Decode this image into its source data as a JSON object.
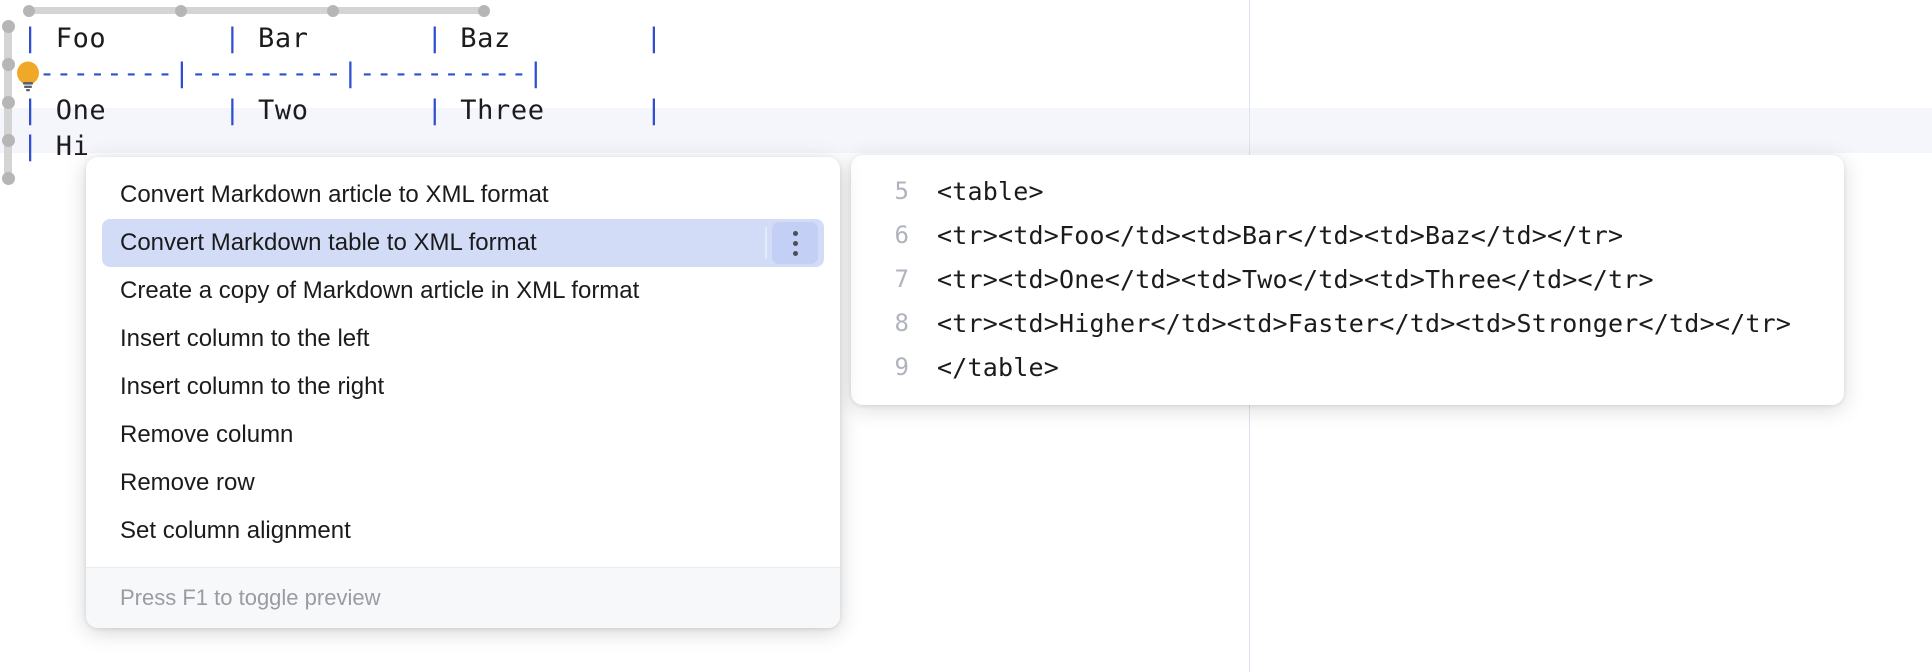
{
  "editor": {
    "markdown_lines": [
      {
        "id": "header",
        "text": "| Foo       | Bar       | Baz        |"
      },
      {
        "id": "separator",
        "text": "|---------|---------|----------|"
      },
      {
        "id": "row_one",
        "text": "| One       | Two       | Three      |"
      },
      {
        "id": "row_higher",
        "text": "| Hi"
      }
    ],
    "table": {
      "headers": [
        "Foo",
        "Bar",
        "Baz"
      ],
      "rows": [
        [
          "One",
          "Two",
          "Three"
        ],
        [
          "Higher",
          "Faster",
          "Stronger"
        ]
      ]
    },
    "column_handles": {
      "count": 4,
      "name": "column-resize-handle"
    },
    "row_handles": {
      "count": 5,
      "name": "row-select-handle"
    },
    "intention_icon": "lightbulb-icon",
    "margin_guide_color": "#dde3f0",
    "caret_row_highlight_color": "#f4f6fb",
    "pipe_color": "#2f4fd0",
    "text_color": "#1c1c1e"
  },
  "intention_popup": {
    "items": [
      {
        "label": "Convert Markdown article to XML format",
        "selected": false
      },
      {
        "label": "Convert Markdown table to XML format",
        "selected": true
      },
      {
        "label": "Create a copy of Markdown article in XML format",
        "selected": false
      },
      {
        "label": "Insert column to the left",
        "selected": false
      },
      {
        "label": "Insert column to the right",
        "selected": false
      },
      {
        "label": "Remove column",
        "selected": false
      },
      {
        "label": "Remove row",
        "selected": false
      },
      {
        "label": "Set column alignment",
        "selected": false
      }
    ],
    "selected_index": 1,
    "selection_color": "#d3dcf7",
    "submenu_icon": "kebab-menu-icon",
    "footer_hint": "Press F1 to toggle preview"
  },
  "xml_preview": {
    "lines": [
      {
        "number": "5",
        "code": "<table>"
      },
      {
        "number": "6",
        "code": "<tr><td>Foo</td><td>Bar</td><td>Baz</td></tr>"
      },
      {
        "number": "7",
        "code": "<tr><td>One</td><td>Two</td><td>Three</td></tr>"
      },
      {
        "number": "8",
        "code": "<tr><td>Higher</td><td>Faster</td><td>Stronger</td></tr>"
      },
      {
        "number": "9",
        "code": "</table>"
      }
    ]
  }
}
